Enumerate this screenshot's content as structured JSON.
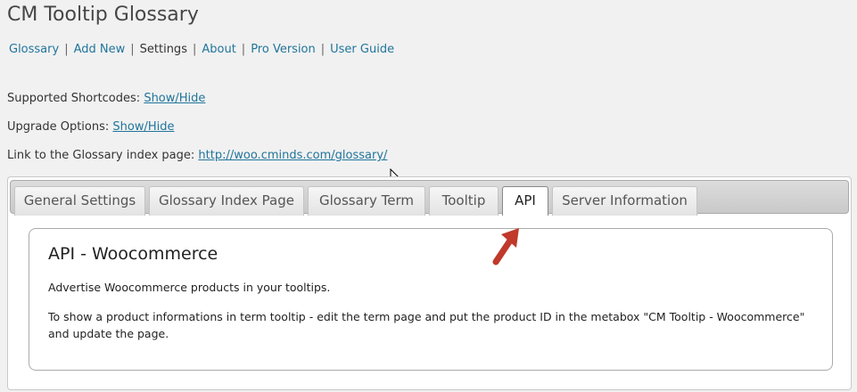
{
  "page": {
    "title": "CM Tooltip Glossary"
  },
  "subnav": {
    "items": [
      {
        "label": "Glossary"
      },
      {
        "label": "Add New"
      },
      {
        "label": "Settings"
      },
      {
        "label": "About"
      },
      {
        "label": "Pro Version"
      },
      {
        "label": "User Guide"
      }
    ],
    "current": "Settings",
    "separator": "|"
  },
  "options": {
    "shortcodes_label": "Supported Shortcodes:",
    "shortcodes_link": "Show/Hide",
    "upgrade_label": "Upgrade Options:",
    "upgrade_link": "Show/Hide",
    "index_label": "Link to the Glossary index page:",
    "index_link": "http://woo.cminds.com/glossary/"
  },
  "tabs": {
    "items": [
      {
        "label": "General Settings"
      },
      {
        "label": "Glossary Index Page"
      },
      {
        "label": "Glossary Term"
      },
      {
        "label": "Tooltip"
      },
      {
        "label": "API"
      },
      {
        "label": "Server Information"
      }
    ],
    "active": "API"
  },
  "content": {
    "title": "API - Woocommerce",
    "p1": "Advertise Woocommerce products in your tooltips.",
    "p2": "To show a product informations in term tooltip - edit the term page and put the product ID in the metabox \"CM Tooltip - Woocommerce\" and update the page."
  },
  "colors": {
    "link": "#21759b",
    "arrow": "#c0392b"
  },
  "icons": {
    "cursor": "mouse-cursor-icon",
    "annotation": "annotation-arrow-icon"
  }
}
